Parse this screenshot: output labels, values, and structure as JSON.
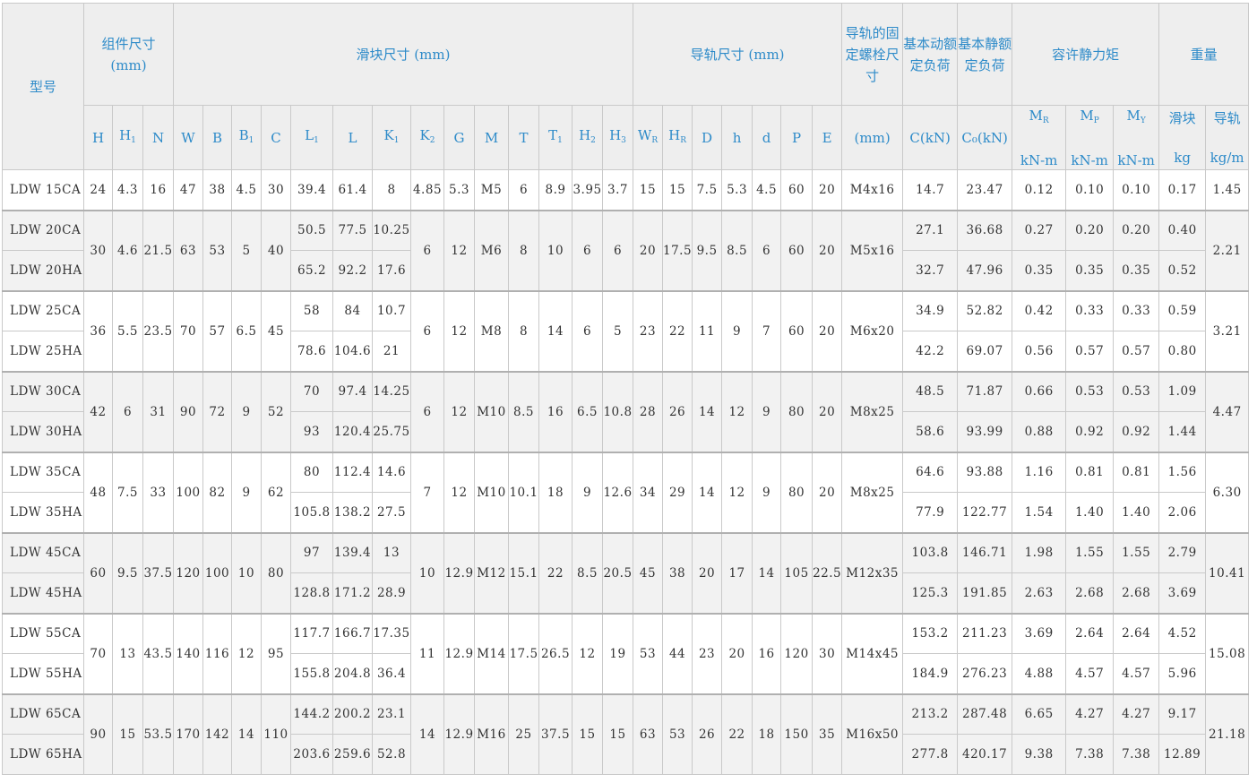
{
  "header": {
    "model": "型号",
    "assembly": "组件尺寸(mm)",
    "block": "滑块尺寸 (mm)",
    "rail": "导轨尺寸 (mm)",
    "bolt": "导轨的固定螺栓尺寸",
    "dyn": "基本动额定负荷",
    "stat": "基本静额定负荷",
    "moment": "容许静力矩",
    "weight": "重量",
    "bolt_unit": "(mm)",
    "c_unit": "C(kN)",
    "c0_unit": "C₀(kN)",
    "knm": "kN-m",
    "kg": "kg",
    "kgm": "kg/m",
    "w_block": "滑块",
    "w_rail": "导轨"
  },
  "symbols": {
    "H": "H",
    "H1": "H",
    "N": "N",
    "W": "W",
    "B": "B",
    "B1": "B",
    "C": "C",
    "L1": "L",
    "L": "L",
    "K1": "K",
    "K2": "K",
    "G": "G",
    "M": "M",
    "T": "T",
    "T1": "T",
    "H2": "H",
    "H3": "H",
    "WR": "W",
    "HR": "H",
    "D": "D",
    "h": "h",
    "d": "d",
    "P": "P",
    "E": "E",
    "MR": "M",
    "MP": "M",
    "MY": "M",
    "sub1": "1",
    "sub2": "2",
    "sub3": "3",
    "subR": "R",
    "subP": "P",
    "subY": "Y"
  },
  "rows": [
    {
      "m1": "LDW 15CA",
      "H": "24",
      "H1": "4.3",
      "N": "16",
      "W": "47",
      "B": "38",
      "B1": "4.5",
      "C": "30",
      "L1a": "39.4",
      "La": "61.4",
      "K1a": "8",
      "K2": "4.85",
      "G": "5.3",
      "M": "M5",
      "T": "6",
      "T1": "8.9",
      "H2": "3.95",
      "H3": "3.7",
      "WR": "15",
      "HR": "15",
      "D": "7.5",
      "h": "5.3",
      "d": "4.5",
      "P": "60",
      "E": "20",
      "bolt": "M4x16",
      "Ca": "14.7",
      "C0a": "23.47",
      "MRa": "0.12",
      "MPa": "0.10",
      "MYa": "0.10",
      "wba": "0.17",
      "wr": "1.45"
    },
    {
      "m1": "LDW 20CA",
      "m2": "LDW 20HA",
      "H": "30",
      "H1": "4.6",
      "N": "21.5",
      "W": "63",
      "B": "53",
      "B1": "5",
      "C": "40",
      "L1a": "50.5",
      "L1b": "65.2",
      "La": "77.5",
      "Lb": "92.2",
      "K1a": "10.25",
      "K1b": "17.6",
      "K2": "6",
      "G": "12",
      "M": "M6",
      "T": "8",
      "T1": "10",
      "H2": "6",
      "H3": "6",
      "WR": "20",
      "HR": "17.5",
      "D": "9.5",
      "h": "8.5",
      "d": "6",
      "P": "60",
      "E": "20",
      "bolt": "M5x16",
      "Ca": "27.1",
      "Cb": "32.7",
      "C0a": "36.68",
      "C0b": "47.96",
      "MRa": "0.27",
      "MRb": "0.35",
      "MPa": "0.20",
      "MPb": "0.35",
      "MYa": "0.20",
      "MYb": "0.35",
      "wba": "0.40",
      "wbb": "0.52",
      "wr": "2.21"
    },
    {
      "m1": "LDW 25CA",
      "m2": "LDW 25HA",
      "H": "36",
      "H1": "5.5",
      "N": "23.5",
      "W": "70",
      "B": "57",
      "B1": "6.5",
      "C": "45",
      "L1a": "58",
      "L1b": "78.6",
      "La": "84",
      "Lb": "104.6",
      "K1a": "10.7",
      "K1b": "21",
      "K2": "6",
      "G": "12",
      "M": "M8",
      "T": "8",
      "T1": "14",
      "H2": "6",
      "H3": "5",
      "WR": "23",
      "HR": "22",
      "D": "11",
      "h": "9",
      "d": "7",
      "P": "60",
      "E": "20",
      "bolt": "M6x20",
      "Ca": "34.9",
      "Cb": "42.2",
      "C0a": "52.82",
      "C0b": "69.07",
      "MRa": "0.42",
      "MRb": "0.56",
      "MPa": "0.33",
      "MPb": "0.57",
      "MYa": "0.33",
      "MYb": "0.57",
      "wba": "0.59",
      "wbb": "0.80",
      "wr": "3.21"
    },
    {
      "m1": "LDW 30CA",
      "m2": "LDW 30HA",
      "H": "42",
      "H1": "6",
      "N": "31",
      "W": "90",
      "B": "72",
      "B1": "9",
      "C": "52",
      "L1a": "70",
      "L1b": "93",
      "La": "97.4",
      "Lb": "120.4",
      "K1a": "14.25",
      "K1b": "25.75",
      "K2": "6",
      "G": "12",
      "M": "M10",
      "T": "8.5",
      "T1": "16",
      "H2": "6.5",
      "H3": "10.8",
      "WR": "28",
      "HR": "26",
      "D": "14",
      "h": "12",
      "d": "9",
      "P": "80",
      "E": "20",
      "bolt": "M8x25",
      "Ca": "48.5",
      "Cb": "58.6",
      "C0a": "71.87",
      "C0b": "93.99",
      "MRa": "0.66",
      "MRb": "0.88",
      "MPa": "0.53",
      "MPb": "0.92",
      "MYa": "0.53",
      "MYb": "0.92",
      "wba": "1.09",
      "wbb": "1.44",
      "wr": "4.47"
    },
    {
      "m1": "LDW 35CA",
      "m2": "LDW 35HA",
      "H": "48",
      "H1": "7.5",
      "N": "33",
      "W": "100",
      "B": "82",
      "B1": "9",
      "C": "62",
      "L1a": "80",
      "L1b": "105.8",
      "La": "112.4",
      "Lb": "138.2",
      "K1a": "14.6",
      "K1b": "27.5",
      "K2": "7",
      "G": "12",
      "M": "M10",
      "T": "10.1",
      "T1": "18",
      "H2": "9",
      "H3": "12.6",
      "WR": "34",
      "HR": "29",
      "D": "14",
      "h": "12",
      "d": "9",
      "P": "80",
      "E": "20",
      "bolt": "M8x25",
      "Ca": "64.6",
      "Cb": "77.9",
      "C0a": "93.88",
      "C0b": "122.77",
      "MRa": "1.16",
      "MRb": "1.54",
      "MPa": "0.81",
      "MPb": "1.40",
      "MYa": "0.81",
      "MYb": "1.40",
      "wba": "1.56",
      "wbb": "2.06",
      "wr": "6.30"
    },
    {
      "m1": "LDW 45CA",
      "m2": "LDW 45HA",
      "H": "60",
      "H1": "9.5",
      "N": "37.5",
      "W": "120",
      "B": "100",
      "B1": "10",
      "C": "80",
      "L1a": "97",
      "L1b": "128.8",
      "La": "139.4",
      "Lb": "171.2",
      "K1a": "13",
      "K1b": "28.9",
      "K2": "10",
      "G": "12.9",
      "M": "M12",
      "T": "15.1",
      "T1": "22",
      "H2": "8.5",
      "H3": "20.5",
      "WR": "45",
      "HR": "38",
      "D": "20",
      "h": "17",
      "d": "14",
      "P": "105",
      "E": "22.5",
      "bolt": "M12x35",
      "Ca": "103.8",
      "Cb": "125.3",
      "C0a": "146.71",
      "C0b": "191.85",
      "MRa": "1.98",
      "MRb": "2.63",
      "MPa": "1.55",
      "MPb": "2.68",
      "MYa": "1.55",
      "MYb": "2.68",
      "wba": "2.79",
      "wbb": "3.69",
      "wr": "10.41"
    },
    {
      "m1": "LDW 55CA",
      "m2": "LDW 55HA",
      "H": "70",
      "H1": "13",
      "N": "43.5",
      "W": "140",
      "B": "116",
      "B1": "12",
      "C": "95",
      "L1a": "117.7",
      "L1b": "155.8",
      "La": "166.7",
      "Lb": "204.8",
      "K1a": "17.35",
      "K1b": "36.4",
      "K2": "11",
      "G": "12.9",
      "M": "M14",
      "T": "17.5",
      "T1": "26.5",
      "H2": "12",
      "H3": "19",
      "WR": "53",
      "HR": "44",
      "D": "23",
      "h": "20",
      "d": "16",
      "P": "120",
      "E": "30",
      "bolt": "M14x45",
      "Ca": "153.2",
      "Cb": "184.9",
      "C0a": "211.23",
      "C0b": "276.23",
      "MRa": "3.69",
      "MRb": "4.88",
      "MPa": "2.64",
      "MPb": "4.57",
      "MYa": "2.64",
      "MYb": "4.57",
      "wba": "4.52",
      "wbb": "5.96",
      "wr": "15.08"
    },
    {
      "m1": "LDW 65CA",
      "m2": "LDW 65HA",
      "H": "90",
      "H1": "15",
      "N": "53.5",
      "W": "170",
      "B": "142",
      "B1": "14",
      "C": "110",
      "L1a": "144.2",
      "L1b": "203.6",
      "La": "200.2",
      "Lb": "259.6",
      "K1a": "23.1",
      "K1b": "52.8",
      "K2": "14",
      "G": "12.9",
      "M": "M16",
      "T": "25",
      "T1": "37.5",
      "H2": "15",
      "H3": "15",
      "WR": "63",
      "HR": "53",
      "D": "26",
      "h": "22",
      "d": "18",
      "P": "150",
      "E": "35",
      "bolt": "M16x50",
      "Ca": "213.2",
      "Cb": "277.8",
      "C0a": "287.48",
      "C0b": "420.17",
      "MRa": "6.65",
      "MRb": "9.38",
      "MPa": "4.27",
      "MPb": "7.38",
      "MYa": "4.27",
      "MYb": "7.38",
      "wba": "9.17",
      "wbb": "12.89",
      "wr": "21.18"
    }
  ]
}
